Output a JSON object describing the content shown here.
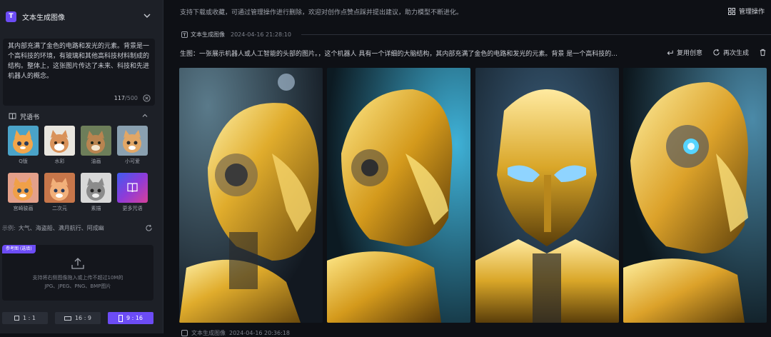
{
  "sidebar": {
    "logo_letter": "T",
    "title": "文本生成图像",
    "prompt": {
      "text": "其内部充满了金色的电路和发光的元素。背景是一个高科技的环境，有玻璃和其他高科技材料制成的结构。整体上，这张图片传达了未来、科技和先进机器人的概念。",
      "count": "117",
      "max": "/500"
    },
    "styles_heading": "咒语书",
    "styles": [
      {
        "label": "Q版",
        "icon": "cat-thumbnail"
      },
      {
        "label": "水彩",
        "icon": "cat-thumbnail"
      },
      {
        "label": "油画",
        "icon": "cat-thumbnail"
      },
      {
        "label": "小可爱",
        "icon": "cat-thumbnail"
      },
      {
        "label": "宫崎骏画",
        "icon": "cat-thumbnail"
      },
      {
        "label": "二次元",
        "icon": "cat-thumbnail"
      },
      {
        "label": "素描",
        "icon": "cat-thumbnail"
      },
      {
        "label": "更多咒语",
        "icon": "book-icon"
      }
    ],
    "examples_label": "示例:",
    "examples": "大气、海盗船、满月航行、阿成幽",
    "upload": {
      "badge": "参考图 (选填)",
      "line1": "支持将右侧图像拖入或上传不超过10M的",
      "line2": "JPG、JPEG、PNG、BMP图片"
    },
    "ratios": [
      {
        "label": "1 : 1",
        "active": false
      },
      {
        "label": "16 : 9",
        "active": false
      },
      {
        "label": "9 : 16",
        "active": true
      }
    ]
  },
  "main": {
    "notice": "支持下载或收藏，可通过管理操作进行删除，欢迎对创作点赞点踩并提出建议，助力模型不断进化。",
    "manage_label": "管理操作",
    "record": {
      "tag": "文本生成图像",
      "time": "2024-04-16 21:28:10",
      "prompt": "生图：一张展示机器人或人工智能的头部的图片。，这个机器人 具有一个详细的大脑结构，其内部充满了金色的电路和发光的元素。背景 是一个高科技的...",
      "actions": [
        {
          "label": "复用创意",
          "icon": "reuse-icon"
        },
        {
          "label": "再次生成",
          "icon": "regenerate-icon"
        },
        {
          "label": "",
          "icon": "trash-icon"
        }
      ]
    },
    "record2": {
      "tag": "文本生成图像",
      "time": "2024-04-16 20:36:18"
    }
  },
  "colors": {
    "accent": "#6c4cf5",
    "background": "#0e1015",
    "sidebar": "#1d2027",
    "gold": "#d9a628"
  }
}
